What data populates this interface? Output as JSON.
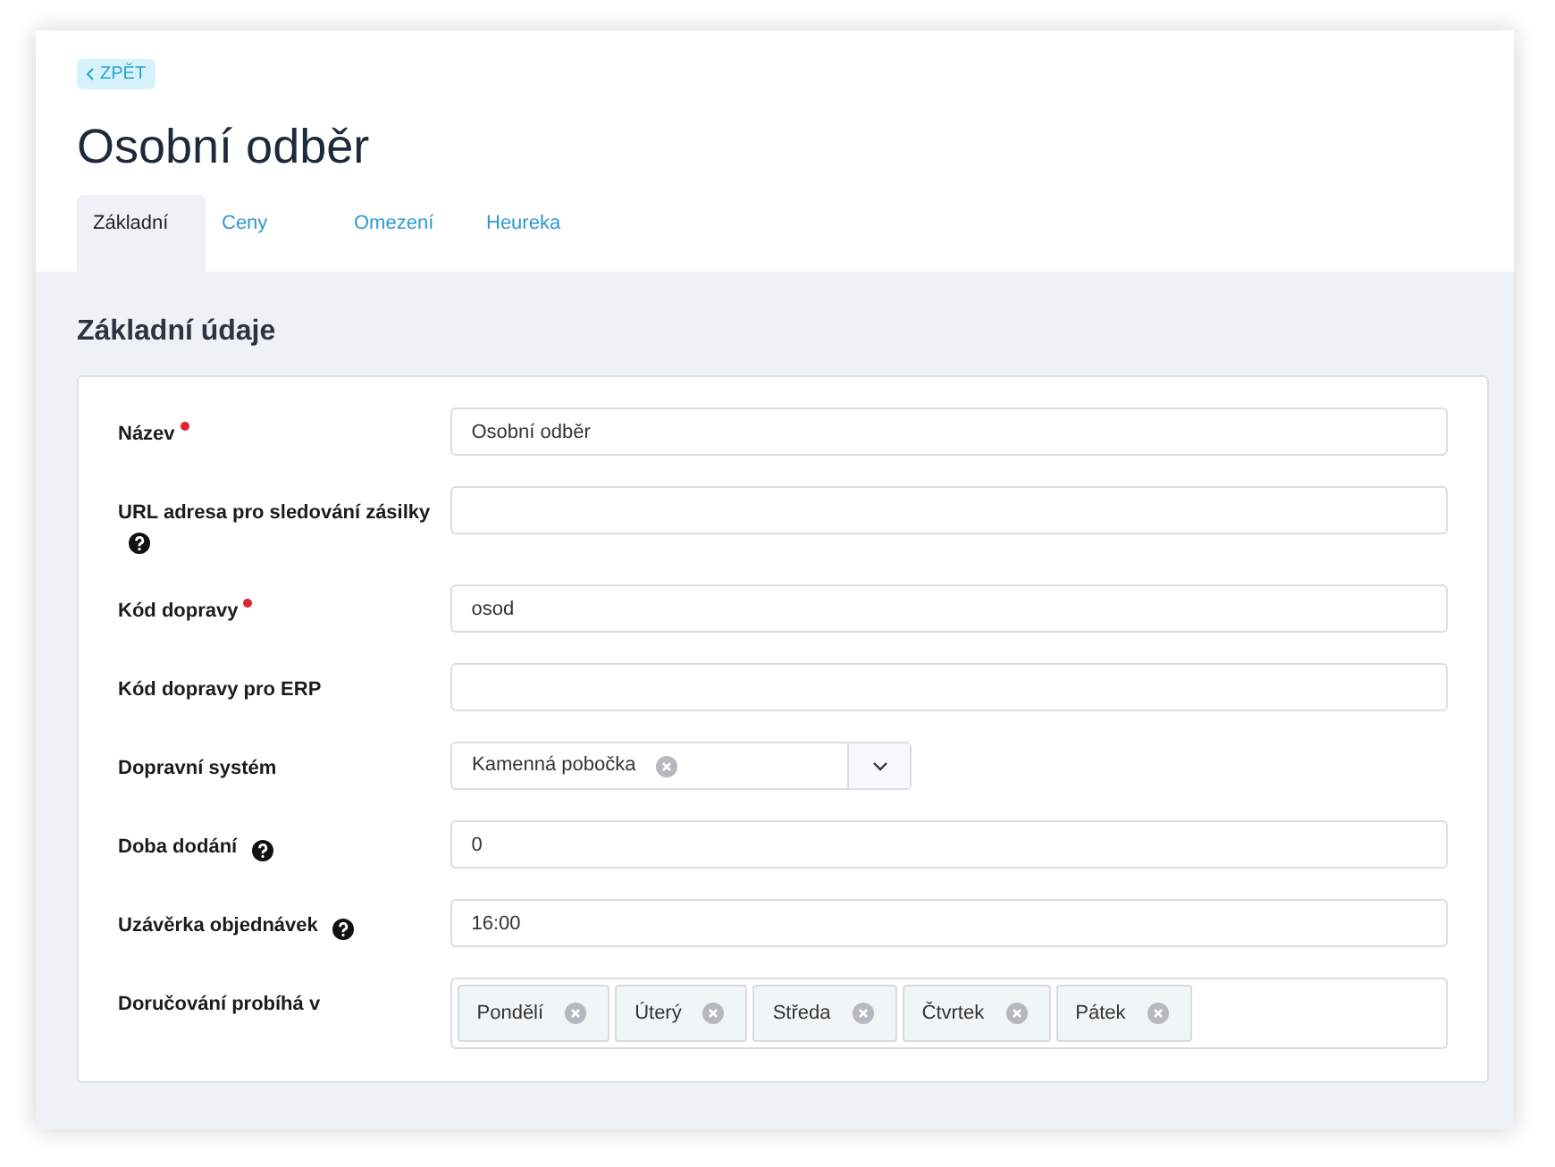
{
  "back_link": "ZPĚT",
  "title": "Osobní odběr",
  "tabs": [
    {
      "label": "Základní",
      "selected": true
    },
    {
      "label": "Ceny",
      "selected": false
    },
    {
      "label": "Omezení",
      "selected": false
    },
    {
      "label": "Heureka",
      "selected": false
    }
  ],
  "section_title": "Základní údaje",
  "fields": [
    {
      "kind": "text",
      "label": "Název",
      "required": true,
      "help": false,
      "value": "Osobní odběr"
    },
    {
      "kind": "text",
      "label": "URL adresa pro sledování zásilky",
      "required": false,
      "help": true
    },
    {
      "kind": "text",
      "label": "Kód dopravy",
      "required": true,
      "help": false,
      "value": "osod"
    },
    {
      "kind": "text",
      "label": "Kód dopravy pro ERP",
      "required": false,
      "help": false
    },
    {
      "kind": "select",
      "label": "Dopravní systém",
      "required": false,
      "help": false,
      "value": "Kamenná pobočka"
    },
    {
      "kind": "text",
      "label": "Doba dodání",
      "required": false,
      "help": true,
      "value": "0"
    },
    {
      "kind": "text",
      "label": "Uzávěrka objednávek",
      "required": false,
      "help": true,
      "value": "16:00"
    },
    {
      "kind": "tags",
      "label": "Doručování probíhá v",
      "required": false,
      "help": false,
      "tags": [
        "Pondělí",
        "Úterý",
        "Středa",
        "Čtvrtek",
        "Pátek"
      ]
    }
  ]
}
